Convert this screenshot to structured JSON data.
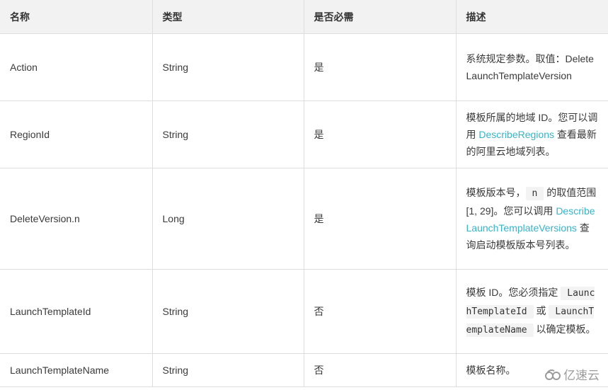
{
  "table": {
    "headers": [
      "名称",
      "类型",
      "是否必需",
      "描述"
    ],
    "rows": [
      {
        "name": "Action",
        "type": "String",
        "required": "是",
        "desc": {
          "text1": "系统规定参数。取值：DeleteLaunchTemplateVersion"
        }
      },
      {
        "name": "RegionId",
        "type": "String",
        "required": "是",
        "desc": {
          "text1": "模板所属的地域 ID。您可以调用 ",
          "link1": "DescribeRegions",
          "text2": " 查看最新的阿里云地域列表。"
        }
      },
      {
        "name": "DeleteVersion.n",
        "type": "Long",
        "required": "是",
        "desc": {
          "text1": "模板版本号，",
          "code1": "n",
          "text2": " 的取值范围 [1, 29]。您可以调用 ",
          "link1": "DescribeLaunchTemplateVersions",
          "text3": " 查询启动模板版本号列表。"
        }
      },
      {
        "name": "LaunchTemplateId",
        "type": "String",
        "required": "否",
        "desc": {
          "text1": "模板 ID。您必须指定 ",
          "code1": "LaunchTemplateId",
          "text2": " 或 ",
          "code2": "LaunchTemplateName",
          "text3": " 以确定模板。"
        }
      },
      {
        "name": "LaunchTemplateName",
        "type": "String",
        "required": "否",
        "desc": {
          "text1": "模板名称。"
        }
      }
    ]
  },
  "watermark": {
    "icon": "cloud-logo-icon",
    "label": "亿速云"
  },
  "colors": {
    "link": "#37b3c8",
    "header_bg": "#f2f2f2",
    "border": "#dddddd",
    "code_bg": "#f3f3f3"
  }
}
